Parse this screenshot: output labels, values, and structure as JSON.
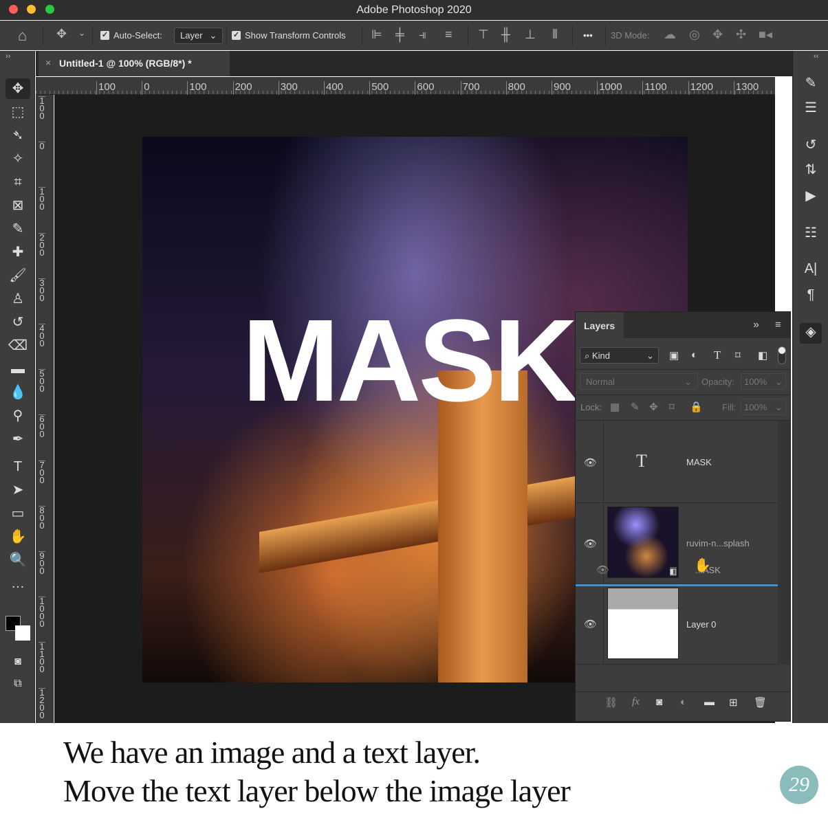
{
  "window": {
    "title": "Adobe Photoshop 2020"
  },
  "options": {
    "auto_select_label": "Auto-Select:",
    "auto_select_value": "Layer",
    "show_transform_label": "Show Transform Controls",
    "mode_3d_label": "3D Mode:",
    "more": "•••"
  },
  "document": {
    "tab_title": "Untitled-1 @ 100% (RGB/8*) *",
    "close": "×"
  },
  "ruler": {
    "h_labels": [
      "100",
      "0",
      "100",
      "200",
      "300",
      "400",
      "500",
      "600",
      "700",
      "800",
      "900",
      "1000",
      "1100",
      "1200",
      "1300"
    ],
    "v_labels": [
      "100",
      "0",
      "100",
      "200",
      "300",
      "400",
      "500",
      "600",
      "700",
      "800",
      "900",
      "1000",
      "1100",
      "1200"
    ]
  },
  "canvas": {
    "text": "MASK"
  },
  "layers_panel": {
    "title": "Layers",
    "filter_label": "Kind",
    "blend_mode": "Normal",
    "opacity_label": "Opacity:",
    "opacity_value": "100%",
    "lock_label": "Lock:",
    "fill_label": "Fill:",
    "fill_value": "100%",
    "layers": [
      {
        "name": "MASK",
        "type": "text",
        "visible": true
      },
      {
        "name": "ruvim-n...splash",
        "type": "smart-object",
        "visible": true
      },
      {
        "name": "Layer 0",
        "type": "pixel",
        "visible": true
      }
    ],
    "drag_ghost_label": "...ASK"
  },
  "caption": {
    "line1": "We have an image and a text layer.",
    "line2": "Move the text layer below the image layer",
    "logo_text": "29"
  },
  "colors": {
    "accent": "#4a90c2",
    "logo": "#8bbcbc"
  }
}
